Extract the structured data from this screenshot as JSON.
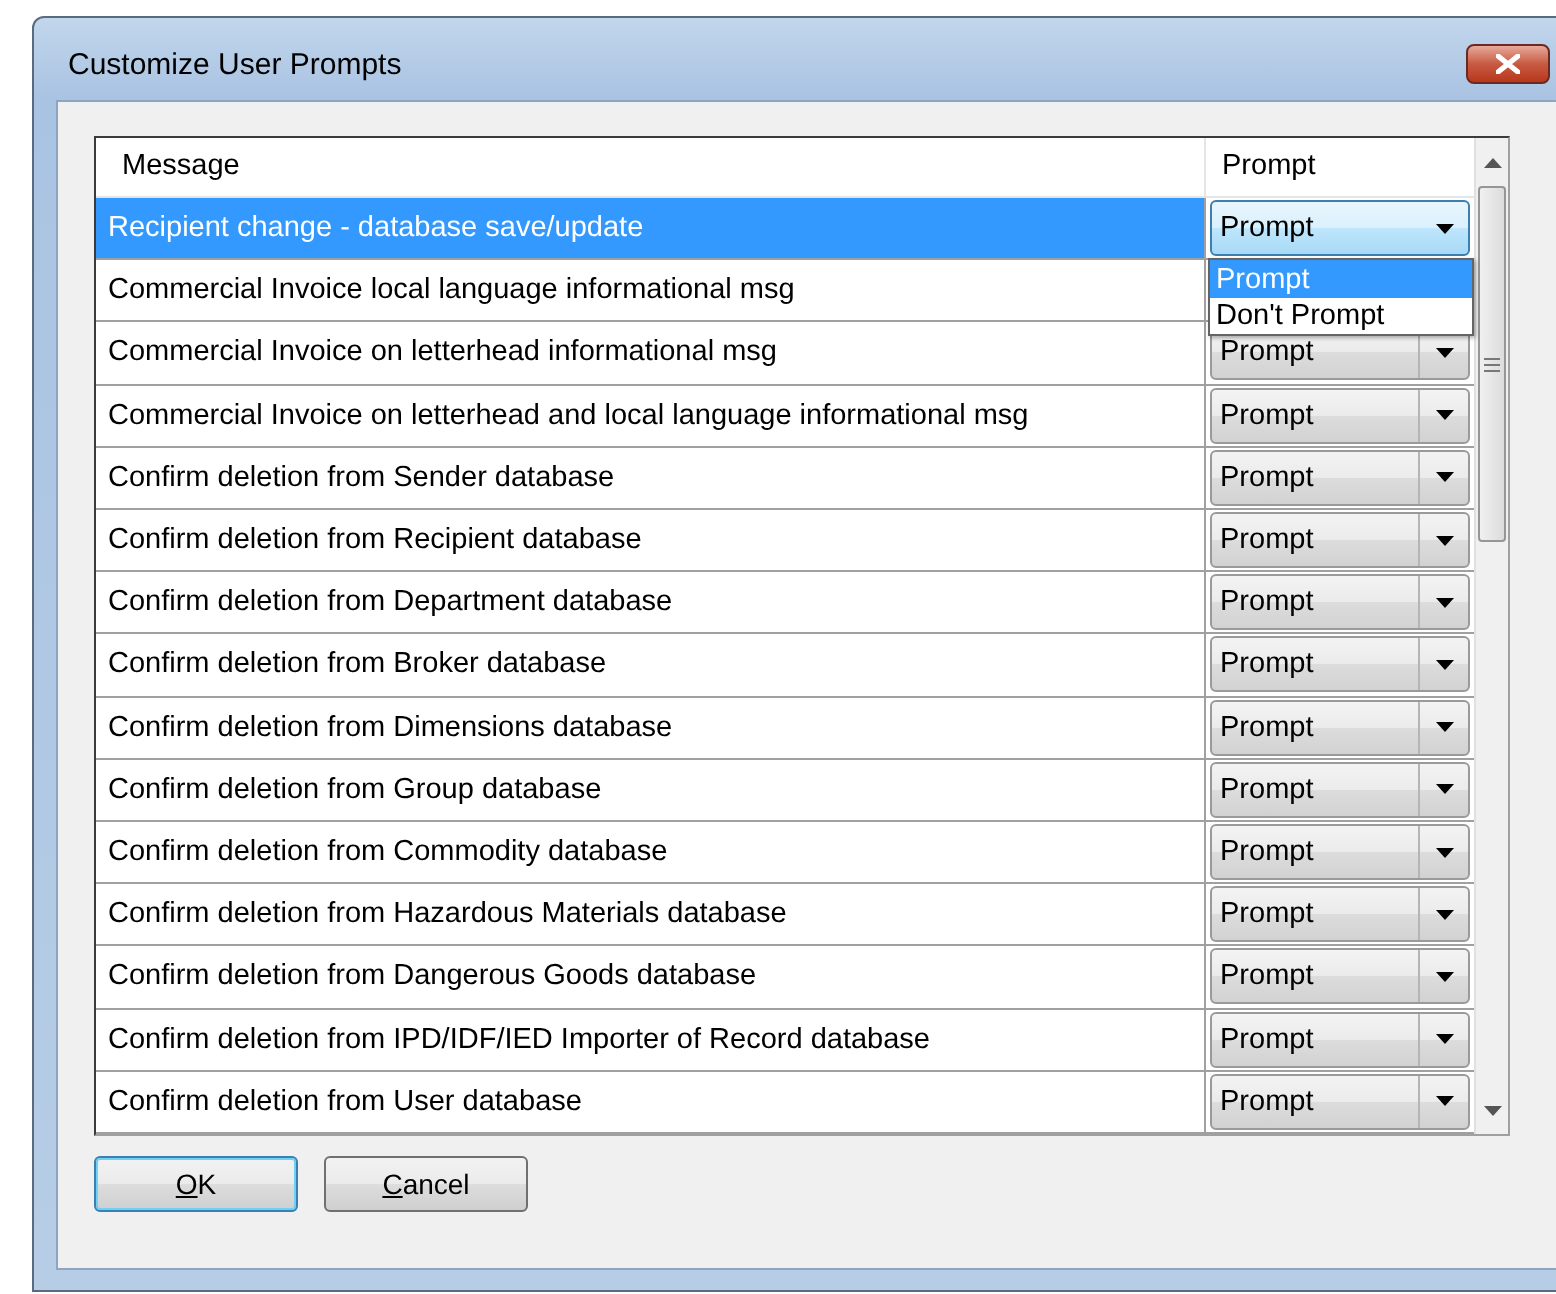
{
  "window": {
    "title": "Customize User Prompts"
  },
  "grid": {
    "columns": [
      "Message",
      "Prompt"
    ],
    "rows": [
      {
        "message": "Recipient change - database save/update",
        "selected": true,
        "prompt": "Prompt"
      },
      {
        "message": "Commercial Invoice local language informational msg",
        "selected": false
      },
      {
        "message": "Commercial Invoice on letterhead informational msg",
        "selected": false,
        "prompt": "Prompt"
      },
      {
        "message": "Commercial Invoice on letterhead and local language informational msg",
        "selected": false,
        "prompt": "Prompt"
      },
      {
        "message": "Confirm deletion from Sender database",
        "selected": false,
        "prompt": "Prompt"
      },
      {
        "message": "Confirm deletion from Recipient database",
        "selected": false,
        "prompt": "Prompt"
      },
      {
        "message": "Confirm deletion from Department database",
        "selected": false,
        "prompt": "Prompt"
      },
      {
        "message": "Confirm deletion from Broker database",
        "selected": false,
        "prompt": "Prompt"
      },
      {
        "message": "Confirm deletion from Dimensions database",
        "selected": false,
        "prompt": "Prompt"
      },
      {
        "message": "Confirm deletion from Group database",
        "selected": false,
        "prompt": "Prompt"
      },
      {
        "message": "Confirm deletion from Commodity database",
        "selected": false,
        "prompt": "Prompt"
      },
      {
        "message": "Confirm deletion from Hazardous Materials database",
        "selected": false,
        "prompt": "Prompt"
      },
      {
        "message": "Confirm deletion from Dangerous Goods database",
        "selected": false,
        "prompt": "Prompt"
      },
      {
        "message": "Confirm deletion from IPD/IDF/IED Importer of Record database",
        "selected": false,
        "prompt": "Prompt"
      },
      {
        "message": "Confirm deletion from User database",
        "selected": false,
        "prompt": "Prompt"
      }
    ],
    "dropdown": {
      "options": [
        {
          "label": "Prompt",
          "selected": true
        },
        {
          "label": "Don't Prompt",
          "selected": false
        }
      ]
    }
  },
  "buttons": [
    {
      "label": "OK",
      "underline_first": true,
      "default": true
    },
    {
      "label": "Cancel",
      "underline_first": true,
      "default": false
    }
  ]
}
